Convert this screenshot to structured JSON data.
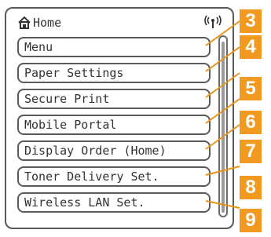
{
  "header": {
    "title": "Home",
    "home_icon": "home-icon",
    "signal_icon": "wireless-signal-icon"
  },
  "menu": [
    {
      "label": "Menu",
      "badge": "3"
    },
    {
      "label": "Paper Settings",
      "badge": "4"
    },
    {
      "label": "Secure Print",
      "badge": "5"
    },
    {
      "label": "Mobile Portal",
      "badge": "6"
    },
    {
      "label": "Display Order (Home)",
      "badge": "7"
    },
    {
      "label": "Toner Delivery Set.",
      "badge": "8"
    },
    {
      "label": "Wireless LAN Set.",
      "badge": "9"
    }
  ],
  "colors": {
    "callout": "#f29a1f",
    "border": "#595959"
  }
}
